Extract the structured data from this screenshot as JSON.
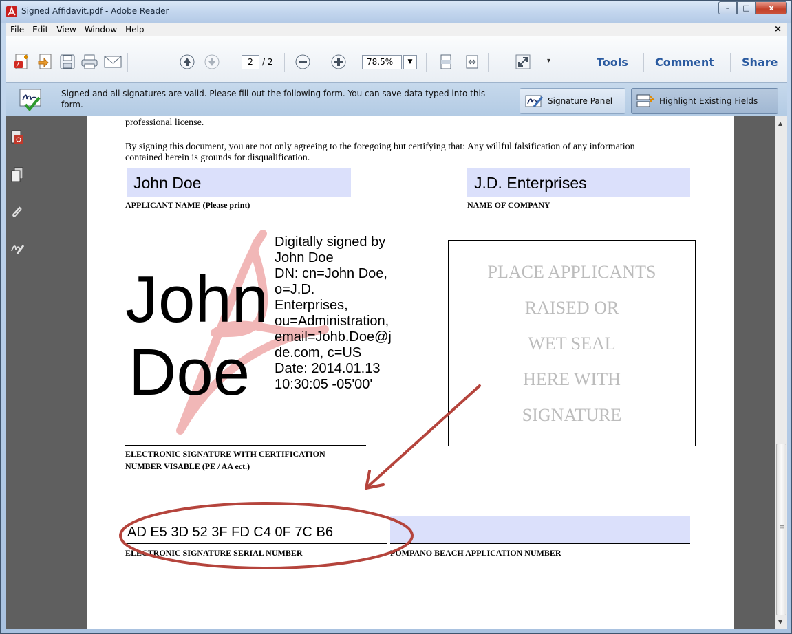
{
  "window": {
    "title": "Signed Affidavit.pdf - Adobe Reader",
    "minimize": "–",
    "maximize": "□",
    "close": "x"
  },
  "menu": {
    "items": [
      "File",
      "Edit",
      "View",
      "Window",
      "Help"
    ],
    "close": "×"
  },
  "toolbar": {
    "current_page": "2",
    "total_pages": "/ 2",
    "zoom": "78.5%",
    "zoom_dropdown": "▼",
    "more": "▾",
    "tools": "Tools",
    "comment": "Comment",
    "share": "Share"
  },
  "message_bar": {
    "text": "Signed and all signatures are valid.  Please fill out the following form. You can save data typed into this form.",
    "signature_panel": "Signature Panel",
    "highlight_fields": "Highlight Existing Fields"
  },
  "document": {
    "para_top": "professional license.",
    "para_certify": "By signing this document, you are not only agreeing to the foregoing but certifying that: Any willful falsification of any information contained herein is grounds for disqualification.",
    "applicant_name_value": "John Doe",
    "applicant_name_label": "APPLICANT NAME (Please print)",
    "company_value": "J.D. Enterprises",
    "company_label": "NAME OF COMPANY",
    "signature": {
      "first": "John",
      "last": "Doe",
      "details": [
        "Digitally signed by",
        "John Doe",
        "DN: cn=John Doe,",
        "o=J.D.",
        "Enterprises,",
        "ou=Administration,",
        "email=Johb.Doe@j",
        "de.com, c=US",
        "Date: 2014.01.13",
        "10:30:05 -05'00'"
      ],
      "label_line1": "ELECTRONIC SIGNATURE WITH CERTIFICATION",
      "label_line2": "NUMBER VISABLE (PE / AA ect.)"
    },
    "seal_box": [
      "PLACE APPLICANTS",
      "RAISED OR",
      "WET SEAL",
      "HERE WITH",
      "SIGNATURE"
    ],
    "serial_value": "AD E5 3D 52 3F FD C4 0F 7C B6",
    "serial_label": "ELECTRONIC SIGNATURE SERIAL NUMBER",
    "application_number_label": "POMPANO BEACH APPLICATION NUMBER"
  },
  "colors": {
    "annotation": "#b5443c",
    "field_fill": "#dbe0fb",
    "link_blue": "#2a5aa0"
  },
  "icons": [
    "adobe-reader-icon",
    "create-pdf-icon",
    "export-icon",
    "save-icon",
    "print-icon",
    "email-icon",
    "previous-page-icon",
    "next-page-icon",
    "zoom-out-icon",
    "zoom-in-icon",
    "fit-page-icon",
    "fit-width-icon",
    "fullscreen-icon",
    "signature-valid-icon",
    "signature-panel-icon",
    "highlight-fields-icon",
    "document-properties-icon",
    "pages-icon",
    "attachments-icon",
    "signatures-icon"
  ]
}
